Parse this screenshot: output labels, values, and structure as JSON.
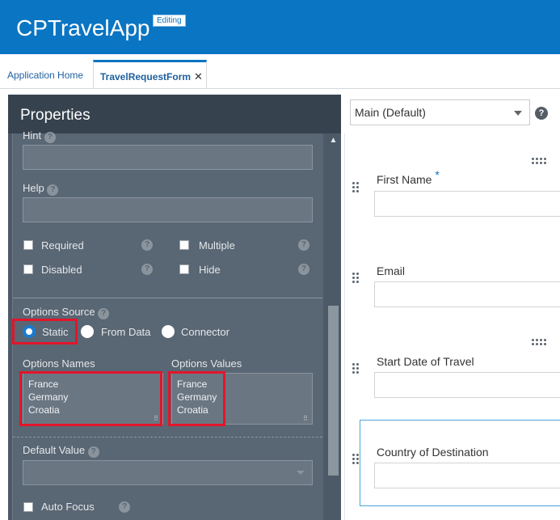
{
  "header": {
    "app_title": "CPTravelApp",
    "badge": "Editing"
  },
  "tabs": [
    {
      "label": "Application Home"
    },
    {
      "label": "TravelRequestForm",
      "close": "✕"
    }
  ],
  "properties": {
    "title": "Properties",
    "hint_label": "Hint",
    "help_label": "Help",
    "help_glyph": "?",
    "checkboxes": {
      "required": "Required",
      "multiple": "Multiple",
      "disabled": "Disabled",
      "hide": "Hide"
    },
    "options_source_label": "Options Source",
    "options_source": {
      "static": "Static",
      "from_data": "From Data",
      "connector": "Connector",
      "selected": "Static"
    },
    "options_names_label": "Options Names",
    "options_values_label": "Options Values",
    "options_names": [
      "France",
      "Germany",
      "Croatia"
    ],
    "options_values": [
      "France",
      "Germany",
      "Croatia"
    ],
    "default_value_label": "Default Value",
    "auto_focus_label": "Auto Focus"
  },
  "form": {
    "view_select": "Main (Default)",
    "fields": [
      {
        "label": "First Name",
        "required_mark": "*"
      },
      {
        "label": "Email"
      },
      {
        "label": "Start Date of Travel"
      },
      {
        "label": "Country of Destination"
      }
    ]
  },
  "colors": {
    "header_bg": "#0a75c2",
    "panel_bg": "#596673",
    "highlight": "#e3152b",
    "radio_on": "#1a7bd0"
  }
}
